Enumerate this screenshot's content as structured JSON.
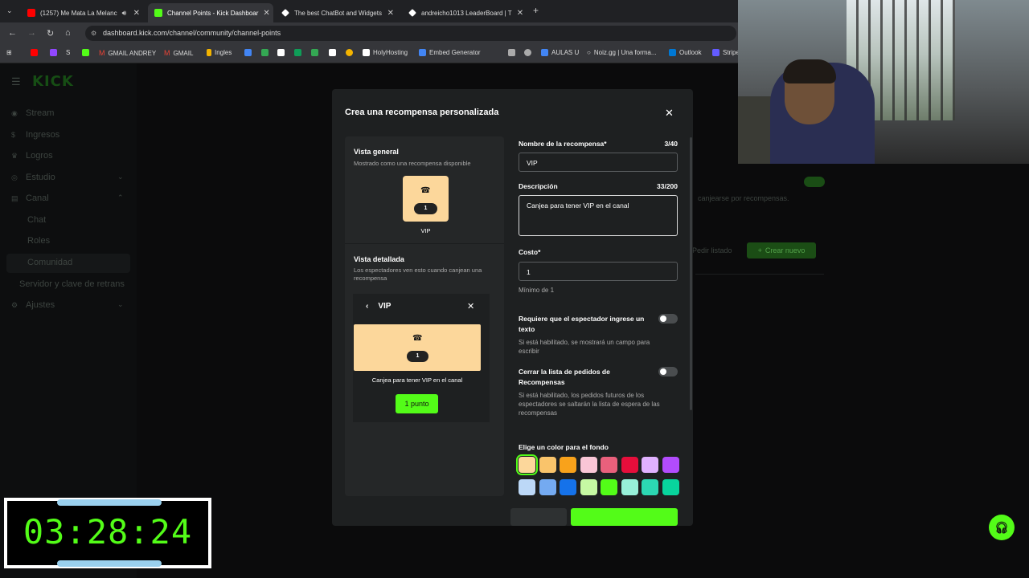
{
  "browser": {
    "tabs": [
      {
        "label": "(1257) Me Mata La Melanc",
        "icon": "youtube-icon",
        "color": "#ff0000"
      },
      {
        "label": "Channel Points - Kick Dashboar",
        "icon": "kick-icon",
        "color": "#53fc18"
      },
      {
        "label": "The best ChatBot and Widgets",
        "icon": "botrix-icon",
        "color": "#ffffff"
      },
      {
        "label": "andreicho1013 LeaderBoard | T",
        "icon": "leaderboard-icon",
        "color": "#ffffff"
      }
    ],
    "url": "dashboard.kick.com/channel/community/channel-points",
    "bookmarks": [
      {
        "label": "",
        "color": "#ff0000"
      },
      {
        "label": "",
        "color": "#9147ff"
      },
      {
        "label": "S",
        "color": "#ffffff"
      },
      {
        "label": "",
        "color": "#53fc18"
      },
      {
        "label": "GMAIL ANDREY",
        "color": "#ea4335"
      },
      {
        "label": "GMAIL",
        "color": "#ea4335"
      },
      {
        "label": "Ingles",
        "color": "#f4b400"
      },
      {
        "label": "",
        "color": "#4285f4"
      },
      {
        "label": "",
        "color": "#34a853"
      },
      {
        "label": "",
        "color": "#ffffff"
      },
      {
        "label": "",
        "color": "#0f9d58"
      },
      {
        "label": "",
        "color": "#34a853"
      },
      {
        "label": "",
        "color": "#ffffff"
      },
      {
        "label": "",
        "color": "#f4b400"
      },
      {
        "label": "",
        "color": "#ff5722"
      },
      {
        "label": "HolyHosting",
        "color": "#ffffff"
      },
      {
        "label": "Embed Generator",
        "color": "#4285f4"
      },
      {
        "label": "",
        "color": "#aaaaaa"
      },
      {
        "label": "",
        "color": "#aaaaaa"
      },
      {
        "label": "AULAS U",
        "color": "#4285f4"
      },
      {
        "label": "Noiz.gg | Una forma...",
        "color": "#ffffff"
      },
      {
        "label": "Outlook",
        "color": "#0078d4"
      },
      {
        "label": "Stripe",
        "color": "#635bff"
      }
    ]
  },
  "sidebar": {
    "logo": "KICK",
    "items": [
      {
        "label": "Stream",
        "icon": "broadcast-icon"
      },
      {
        "label": "Ingresos",
        "icon": "dollar-icon"
      },
      {
        "label": "Logros",
        "icon": "trophy-icon"
      },
      {
        "label": "Estudio",
        "icon": "studio-icon"
      },
      {
        "label": "Canal",
        "icon": "channel-icon"
      }
    ],
    "sub_items": [
      "Chat",
      "Roles",
      "Comunidad"
    ],
    "extra": "Servidor y clave de retrans",
    "settings": "Ajustes"
  },
  "background": {
    "text": "canjearse por recompensas.",
    "pedir": "Pedir listado",
    "crear": "Crear nuevo"
  },
  "modal": {
    "title": "Crea una recompensa personalizada",
    "preview": {
      "overview_title": "Vista general",
      "overview_sub": "Mostrado como una recompensa disponible",
      "reward_cost": "1",
      "reward_name": "VIP",
      "detail_title": "Vista detallada",
      "detail_sub": "Los espectadores ven esto cuando canjean una recompensa",
      "detail_header": "VIP",
      "detail_desc": "Canjea para tener VIP en el canal",
      "detail_button": "1 punto"
    },
    "form": {
      "name_label": "Nombre de la recompensa*",
      "name_count": "3/40",
      "name_value": "VIP",
      "desc_label": "Descripción",
      "desc_count": "33/200",
      "desc_value": "Canjea para tener VIP en el canal",
      "cost_label": "Costo*",
      "cost_value": "1",
      "cost_help": "Mínimo de 1",
      "toggle1_label": "Requiere que el espectador ingrese un texto",
      "toggle1_help": "Si está habilitado, se mostrará un campo para escribir",
      "toggle2_label": "Cerrar la lista de pedidos de Recompensas",
      "toggle2_help": "Si está habilitado, los pedidos futuros de los espectadores se saltarán la lista de espera de las recompensas",
      "color_label": "Elige un color para el fondo",
      "colors_row1": [
        "#fcd79b",
        "#f9c46b",
        "#f8a21b",
        "#f9c6d6",
        "#e9607c",
        "#e60e3b",
        "#e0b1ff",
        "#b24cfd"
      ],
      "colors_row2": [
        "#bcd8f7",
        "#74aaf1",
        "#1572ea",
        "#c6f9a3",
        "#53fc18",
        "#97f0d9",
        "#2cd7b3",
        "#08d49d"
      ],
      "selected_color": "#fcd79b"
    }
  },
  "timer": {
    "value": "03:28:24"
  },
  "colors": {
    "accent": "#53fc18"
  }
}
